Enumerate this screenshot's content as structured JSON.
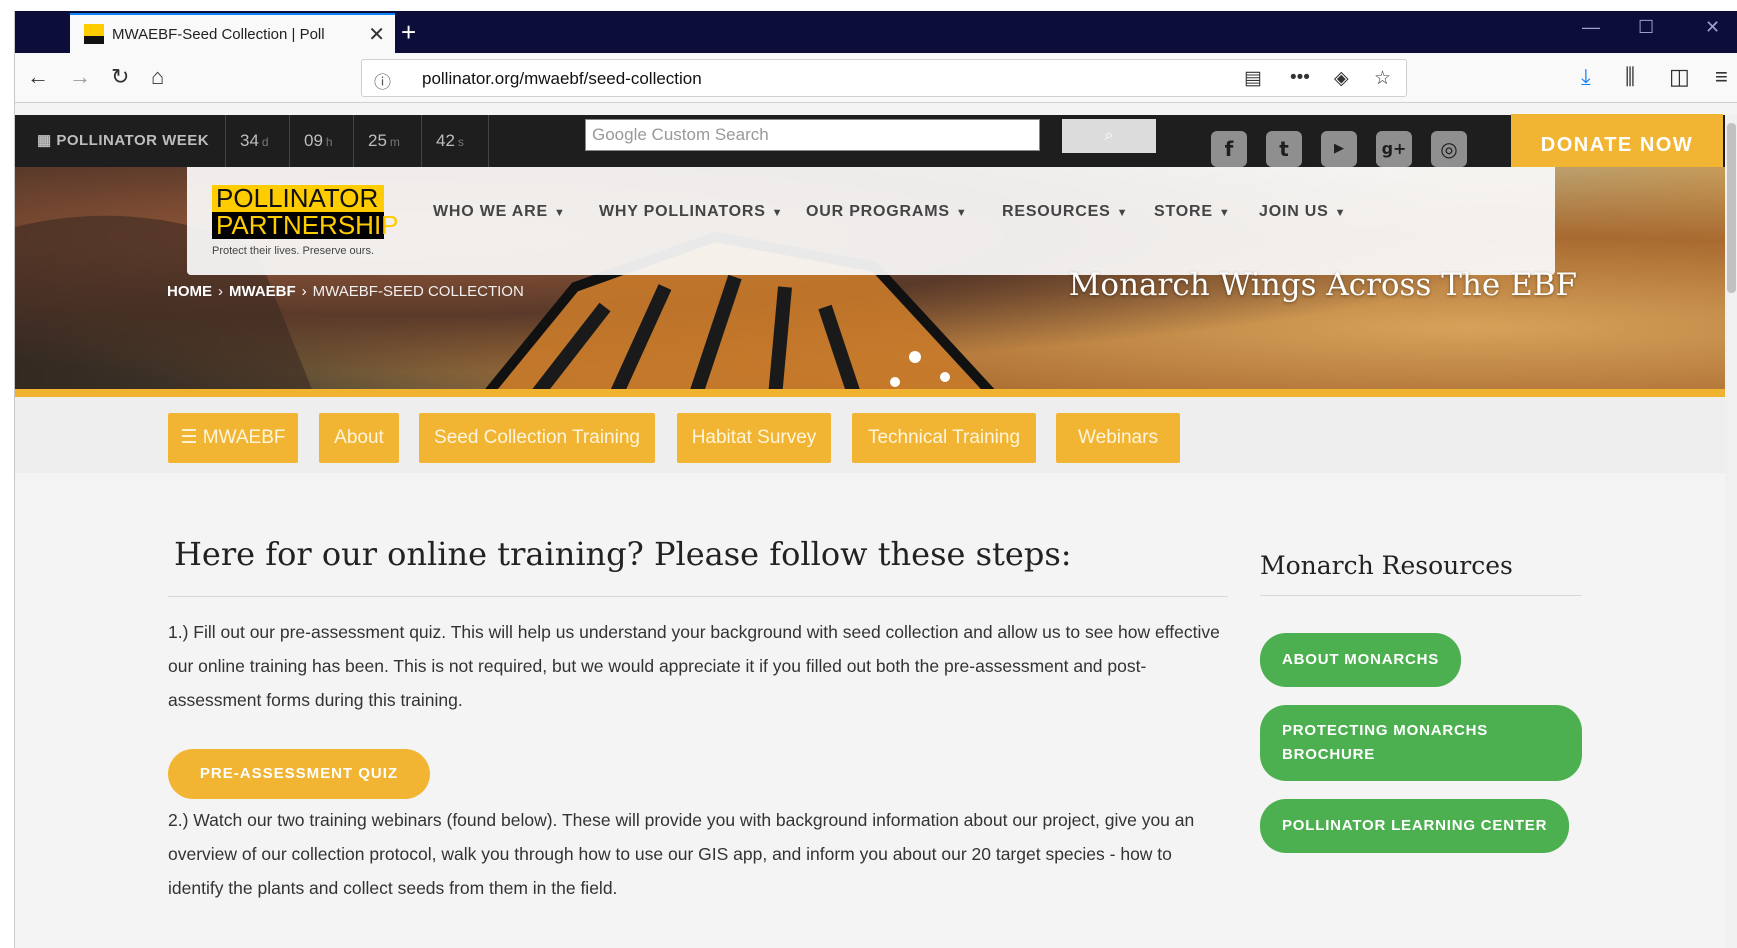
{
  "browser": {
    "tab_title": "MWAEBF-Seed Collection | Poll",
    "tab_close": "✕",
    "new_tab": "+",
    "url": "pollinator.org/mwaebf/seed-collection",
    "controls": {
      "minimize": "—",
      "maximize": "☐",
      "close": "✕"
    }
  },
  "topbar": {
    "week_label": "POLLINATOR WEEK",
    "countdown": [
      {
        "value": "34",
        "unit": "d"
      },
      {
        "value": "09",
        "unit": "h"
      },
      {
        "value": "25",
        "unit": "m"
      },
      {
        "value": "42",
        "unit": "s"
      }
    ],
    "search_placeholder": "Google Custom Search",
    "donate_label": "DONATE NOW",
    "social_icons": [
      "facebook-icon",
      "twitter-icon",
      "youtube-icon",
      "google-plus-icon",
      "instagram-icon"
    ]
  },
  "logo": {
    "line1": "POLLINATOR",
    "line2": "PARTNERSHIP",
    "tagline": "Protect their lives. Preserve ours."
  },
  "menu": {
    "items": [
      {
        "label": "WHO WE ARE"
      },
      {
        "label": "WHY POLLINATORS"
      },
      {
        "label": "OUR PROGRAMS"
      },
      {
        "label": "RESOURCES"
      },
      {
        "label": "STORE"
      },
      {
        "label": "JOIN US"
      }
    ]
  },
  "breadcrumb": {
    "home": "HOME",
    "parent": "MWAEBF",
    "current": "MWAEBF-SEED COLLECTION",
    "separator": "›"
  },
  "hero_title": "Monarch Wings Across The EBF",
  "subnav": {
    "items": [
      {
        "label": "☰ MWAEBF"
      },
      {
        "label": "About"
      },
      {
        "label": "Seed Collection Training"
      },
      {
        "label": "Habitat Survey"
      },
      {
        "label": "Technical Training"
      },
      {
        "label": "Webinars"
      }
    ]
  },
  "main": {
    "title": "Here for our online training? Please follow these steps:",
    "step1": "1.) Fill out our pre-assessment quiz. This will help us understand your background with seed collection and allow us to see how effective our online training has been. This is not required, but we would appreciate it if you filled out both the pre-assessment and post-assessment forms during this training.",
    "quiz_button": "PRE-ASSESSMENT QUIZ",
    "step2": "2.) Watch our two training webinars (found below). These will provide you with background information about our project, give you an overview of our collection protocol, walk you through how to use our GIS app, and inform you about our 20 target species - how to identify the plants and collect seeds from them in the field."
  },
  "sidebar": {
    "title": "Monarch Resources",
    "buttons": [
      {
        "label": "ABOUT MONARCHS"
      },
      {
        "label": "PROTECTING MONARCHS BROCHURE"
      },
      {
        "label": "POLLINATOR LEARNING CENTER"
      }
    ]
  },
  "colors": {
    "accent_yellow": "#f2b533",
    "accent_green": "#4cb050",
    "tabbar": "#0c0d39"
  }
}
